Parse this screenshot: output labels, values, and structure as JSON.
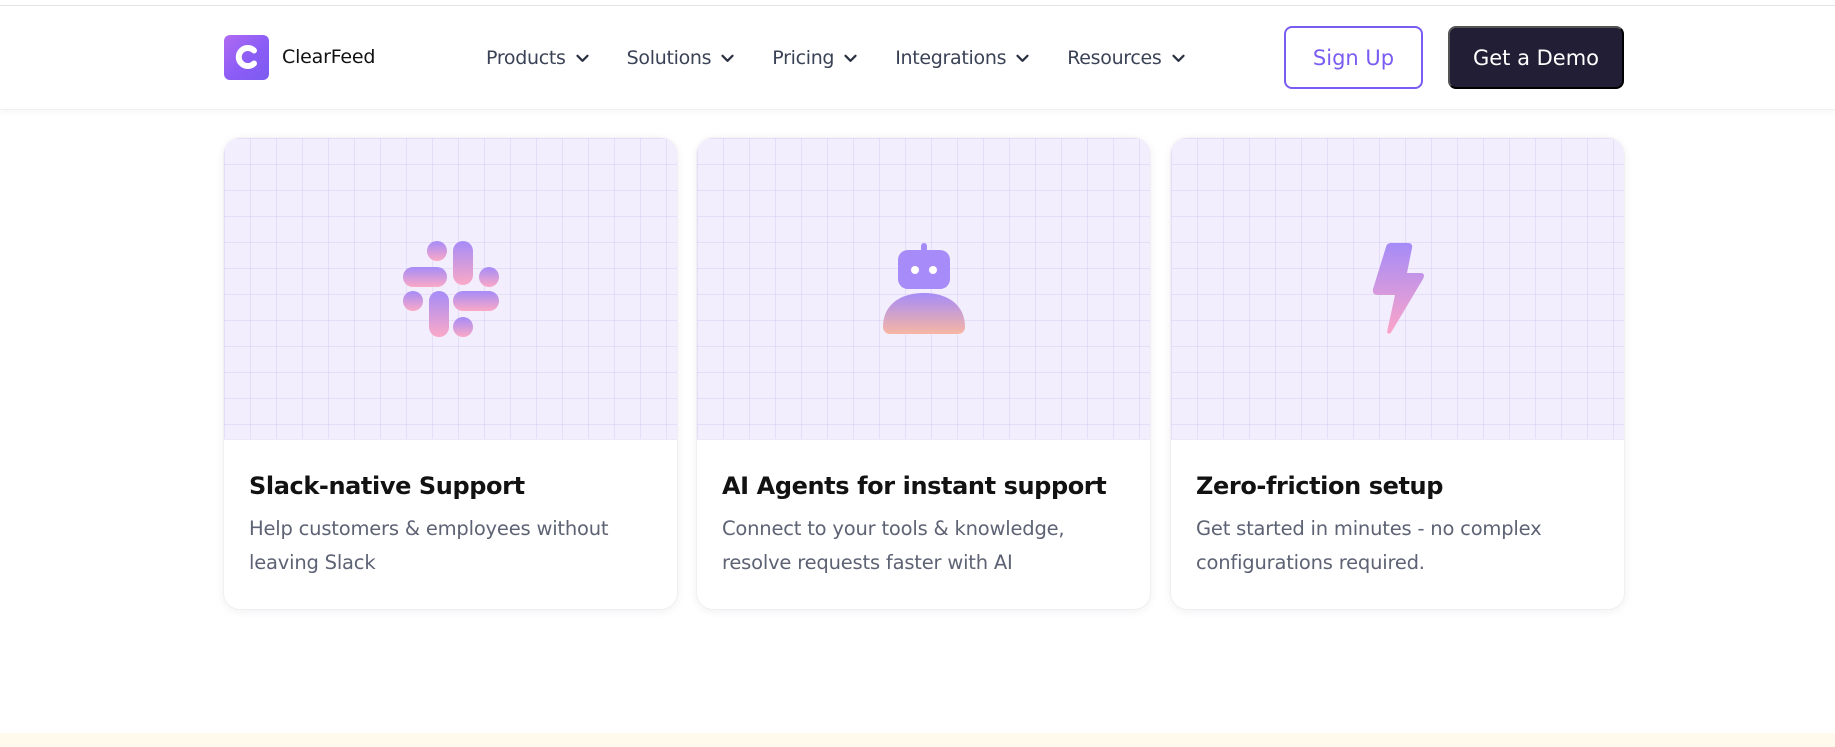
{
  "header": {
    "logo": {
      "letter": "C",
      "name": "ClearFeed"
    },
    "nav": [
      {
        "label": "Products"
      },
      {
        "label": "Solutions"
      },
      {
        "label": "Pricing"
      },
      {
        "label": "Integrations"
      },
      {
        "label": "Resources"
      }
    ],
    "signup_label": "Sign Up",
    "demo_label": "Get a Demo"
  },
  "features": [
    {
      "icon": "slack-icon",
      "title": "Slack-native Support",
      "description": "Help customers & employees without\nleaving Slack"
    },
    {
      "icon": "robot-icon",
      "title": "AI Agents for instant support",
      "description": "Connect to your tools & knowledge,\nresolve requests faster with AI"
    },
    {
      "icon": "lightning-icon",
      "title": "Zero-friction setup",
      "description": "Get started in minutes - no complex\nconfigurations required."
    }
  ],
  "colors": {
    "brand": "#8b5cf6",
    "accent": "#7b5cf2",
    "dark_button": "#211e35",
    "icon_gradient_start": "#a78bfa",
    "icon_gradient_end": "#f9a8c4"
  }
}
